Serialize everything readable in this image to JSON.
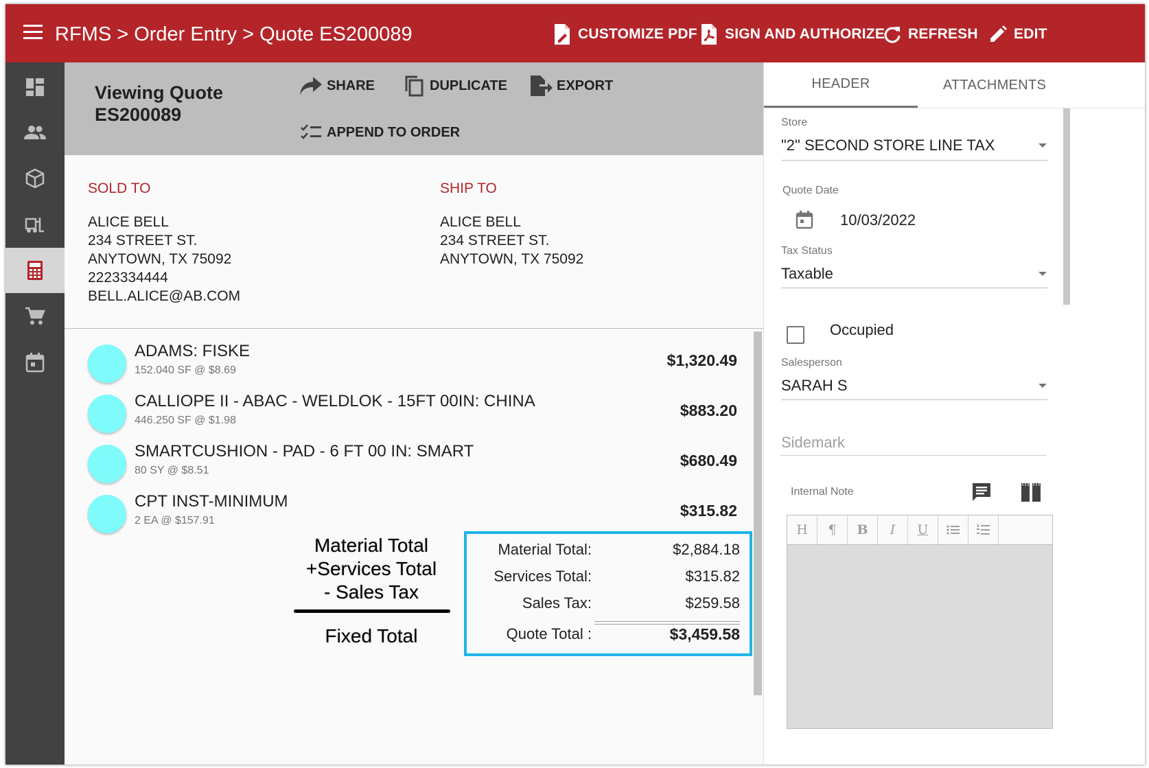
{
  "topbar": {
    "breadcrumb": "RFMS > Order Entry > Quote ES200089",
    "actions": {
      "customize_pdf": "CUSTOMIZE PDF",
      "sign_authorize": "SIGN AND AUTHORIZE",
      "refresh": "REFRESH",
      "edit": "EDIT"
    }
  },
  "quote_header": {
    "title_line1": "Viewing Quote",
    "title_line2": "ES200089",
    "actions": {
      "share": "SHARE",
      "duplicate": "DUPLICATE",
      "export": "EXPORT",
      "append": "APPEND TO ORDER"
    }
  },
  "sold_to": {
    "title": "SOLD TO",
    "lines": [
      "ALICE BELL",
      "234 STREET ST.",
      "ANYTOWN, TX 75092",
      "2223334444",
      "BELL.ALICE@AB.COM"
    ]
  },
  "ship_to": {
    "title": "SHIP TO",
    "lines": [
      "ALICE BELL",
      "234 STREET ST.",
      "ANYTOWN, TX 75092"
    ]
  },
  "line_items": [
    {
      "name": "ADAMS: FISKE",
      "detail": "152.040 SF @ $8.69",
      "price": "$1,320.49"
    },
    {
      "name": "CALLIOPE II - ABAC - WELDLOK - 15FT 00IN: CHINA",
      "detail": "446.250 SF @ $1.98",
      "price": "$883.20"
    },
    {
      "name": "SMARTCUSHION - PAD - 6 FT 00 IN: SMART",
      "detail": "80 SY @ $8.51",
      "price": "$680.49"
    },
    {
      "name": "CPT INST-MINIMUM",
      "detail": "2 EA @ $157.91",
      "price": "$315.82"
    }
  ],
  "annotation": {
    "line1": "Material Total",
    "line2": "+Services Total",
    "line3": "- Sales Tax",
    "result": "Fixed Total"
  },
  "totals": {
    "material_label": "Material Total:",
    "material_value": "$2,884.18",
    "services_label": "Services Total:",
    "services_value": "$315.82",
    "tax_label": "Sales Tax:",
    "tax_value": "$259.58",
    "quote_label": "Quote Total :",
    "quote_value": "$3,459.58",
    "highlight_color": "#1fb4e8"
  },
  "right_panel": {
    "tabs": [
      "HEADER",
      "ATTACHMENTS"
    ],
    "store_label": "Store",
    "store_value": "\"2\" SECOND STORE LINE TAX",
    "quote_date_label": "Quote Date",
    "quote_date_value": "10/03/2022",
    "tax_status_label": "Tax Status",
    "tax_status_value": "Taxable",
    "occupied_label": "Occupied",
    "occupied_checked": false,
    "salesperson_label": "Salesperson",
    "salesperson_value": "SARAH S",
    "sidemark_placeholder": "Sidemark",
    "internal_note_label": "Internal Note",
    "editor_toolbar": [
      "H",
      "¶",
      "B",
      "I",
      "U",
      "bulleted-list",
      "numbered-list"
    ]
  },
  "colors": {
    "brand_red": "#b4252a",
    "rail": "#424242",
    "header_gray": "#bdbdbd",
    "avatar_cyan": "#7ffbfb"
  }
}
